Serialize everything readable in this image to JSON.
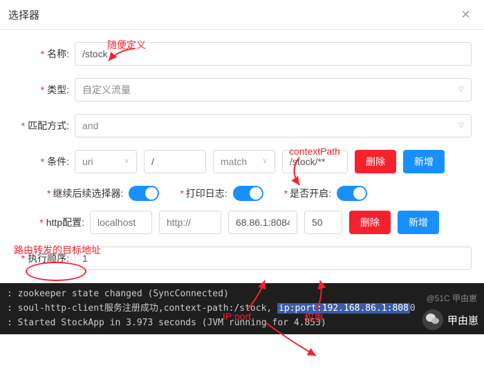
{
  "modal": {
    "title": "选择器",
    "close": "×"
  },
  "fields": {
    "name_label": "名称:",
    "name_value": "/stock",
    "type_label": "类型:",
    "type_value": "自定义流量",
    "match_label": "匹配方式:",
    "match_value": "and",
    "cond_label": "条件:",
    "cond_field": "uri",
    "cond_op_value": "/",
    "cond_match": "match",
    "cond_value": "/stock/**",
    "delete_btn": "删除",
    "add_btn": "新增",
    "continue_label": "继续后续选择器:",
    "log_label": "打印日志:",
    "open_label": "是否开启:",
    "http_label": "http配置:",
    "http_host": "localhost",
    "http_proto": "http://",
    "http_ipport": "68.86.1:8084",
    "http_weight": "50",
    "order_label": "执行顺序:",
    "order_value": "1"
  },
  "annotations": {
    "name_hint": "随便定义",
    "context_path": "contextPath",
    "route_target": "路由转发的目标地址",
    "ipport_hint": "IP:port",
    "weight_hint": "权重"
  },
  "console": {
    "line1": ": zookeeper state changed (SyncConnected)",
    "line2a": ": soul-http-client服务注册成功,context-path:/stock, ",
    "line2b": "ip:port:192.168.86.1:808",
    "line2c": "0",
    "line3": ": Started StockApp in 3.973 seconds (JVM running for 4.853)"
  },
  "watermark": "@51C 甲由崽",
  "footer_name": "甲由崽"
}
